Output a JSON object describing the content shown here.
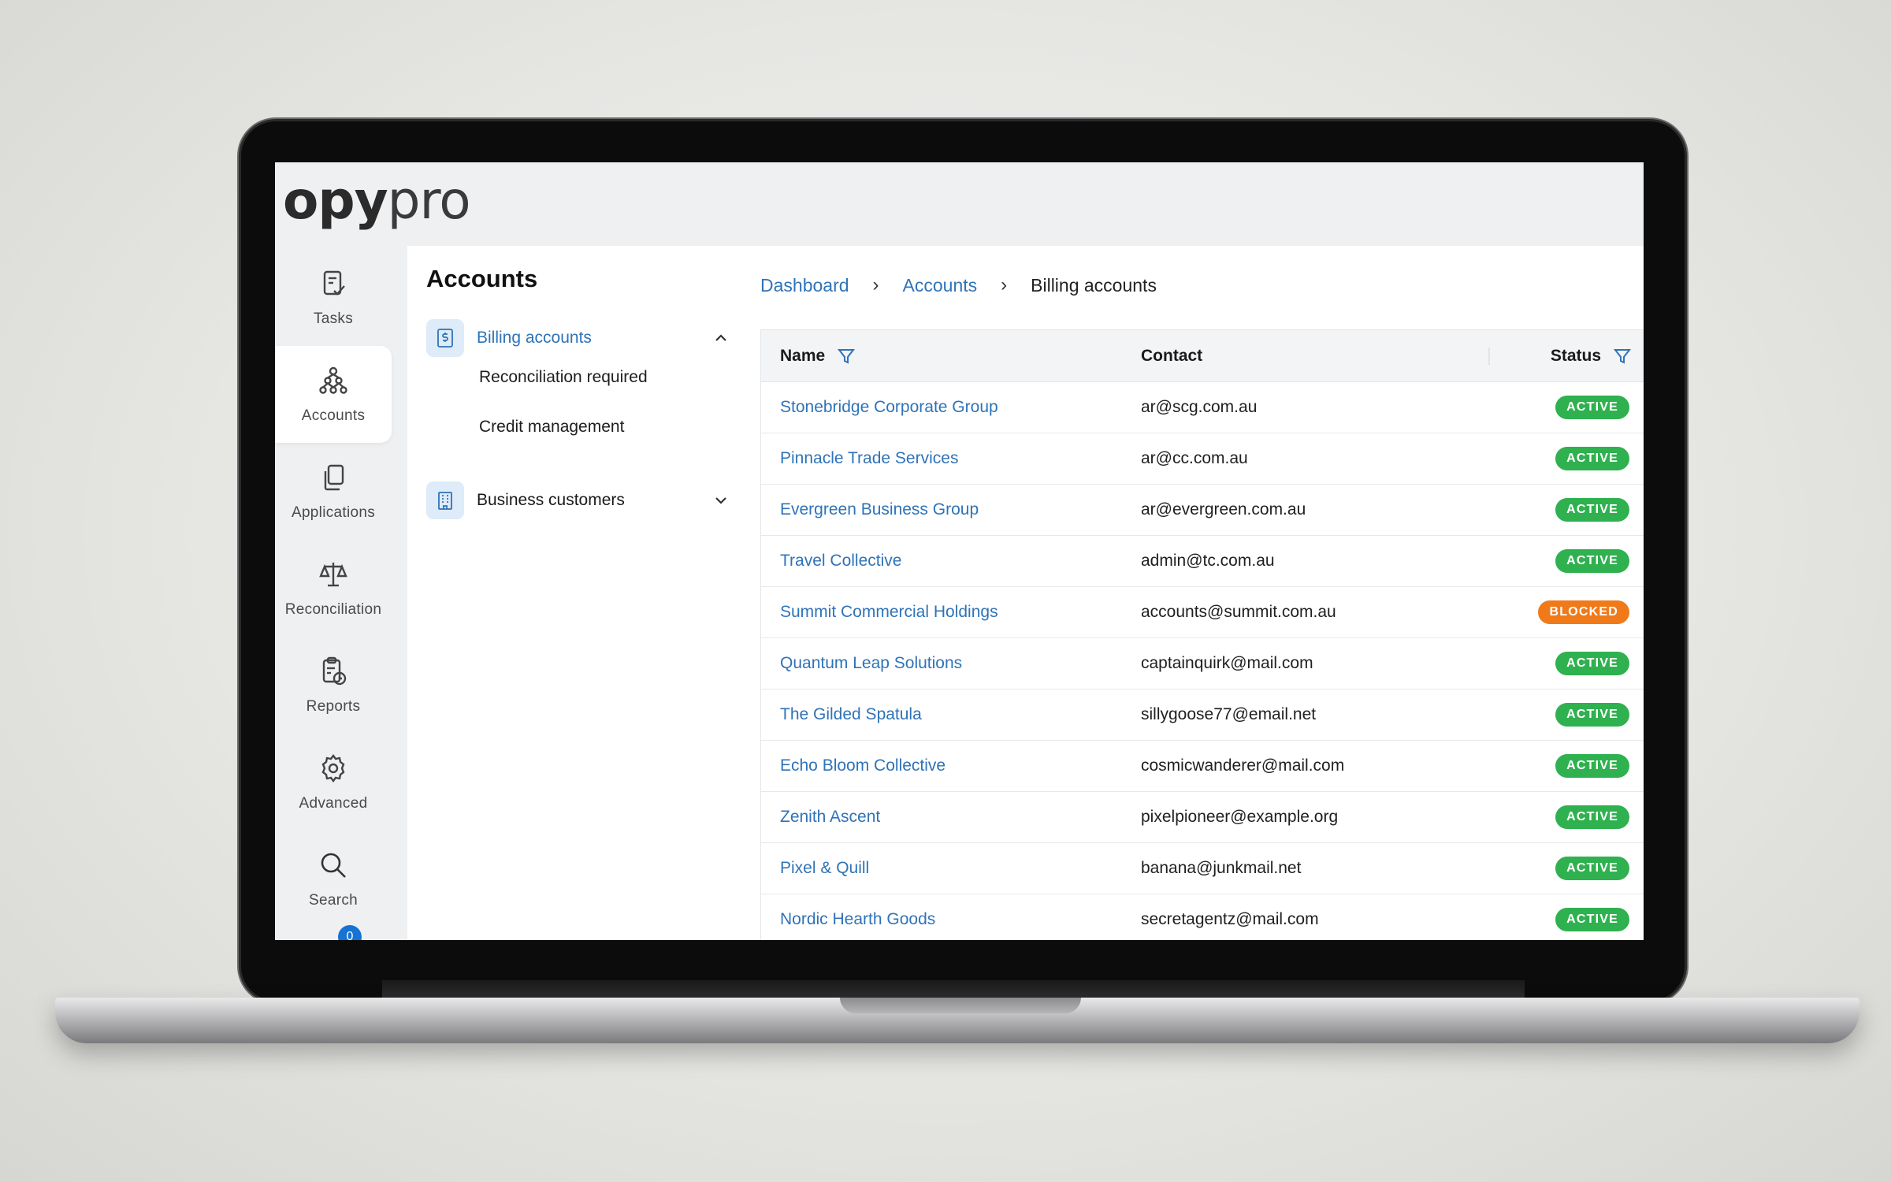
{
  "app": {
    "logo_bold": "opy",
    "logo_light": "pro"
  },
  "rail": {
    "items": [
      {
        "label": "Tasks",
        "icon": "tasks-icon"
      },
      {
        "label": "Accounts",
        "icon": "accounts-icon"
      },
      {
        "label": "Applications",
        "icon": "applications-icon"
      },
      {
        "label": "Reconciliation",
        "icon": "scales-icon"
      },
      {
        "label": "Reports",
        "icon": "reports-icon"
      },
      {
        "label": "Advanced",
        "icon": "gear-icon"
      },
      {
        "label": "Search",
        "icon": "search-icon"
      }
    ],
    "active": "Accounts",
    "badge_count": "0"
  },
  "panel": {
    "title": "Accounts",
    "subnav": {
      "billing_label": "Billing accounts",
      "billing_children": [
        "Reconciliation required",
        "Credit management"
      ],
      "business_label": "Business customers"
    }
  },
  "breadcrumb": [
    "Dashboard",
    "Accounts",
    "Billing accounts"
  ],
  "table": {
    "headers": {
      "name": "Name",
      "contact": "Contact",
      "status": "Status"
    },
    "rows": [
      {
        "name": "Stonebridge Corporate Group",
        "contact": "ar@scg.com.au",
        "status": "ACTIVE"
      },
      {
        "name": "Pinnacle Trade Services",
        "contact": "ar@cc.com.au",
        "status": "ACTIVE"
      },
      {
        "name": "Evergreen Business Group",
        "contact": "ar@evergreen.com.au",
        "status": "ACTIVE"
      },
      {
        "name": "Travel Collective",
        "contact": "admin@tc.com.au",
        "status": "ACTIVE"
      },
      {
        "name": "Summit Commercial Holdings",
        "contact": "accounts@summit.com.au",
        "status": "BLOCKED"
      },
      {
        "name": "Quantum Leap Solutions",
        "contact": "captainquirk@mail.com",
        "status": "ACTIVE"
      },
      {
        "name": "The Gilded Spatula",
        "contact": "sillygoose77@email.net",
        "status": "ACTIVE"
      },
      {
        "name": "Echo Bloom Collective",
        "contact": "cosmicwanderer@mail.com",
        "status": "ACTIVE"
      },
      {
        "name": "Zenith Ascent",
        "contact": "pixelpioneer@example.org",
        "status": "ACTIVE"
      },
      {
        "name": "Pixel & Quill",
        "contact": "banana@junkmail.net",
        "status": "ACTIVE"
      },
      {
        "name": "Nordic Hearth Goods",
        "contact": "secretagentz@mail.com",
        "status": "ACTIVE"
      }
    ]
  },
  "colors": {
    "link": "#2f73b8",
    "active": "#2fb14f",
    "blocked": "#f07a1a",
    "icon_bg": "#deebf8"
  }
}
